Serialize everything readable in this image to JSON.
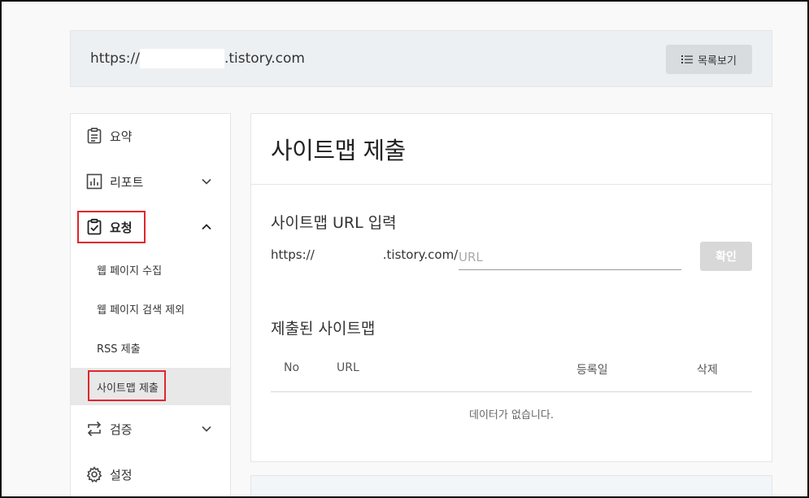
{
  "site_bar": {
    "url_prefix": "https://",
    "url_suffix": ".tistory.com",
    "list_button_label": "목록보기"
  },
  "sidebar": {
    "items": [
      {
        "label": "요약",
        "icon": "clipboard-icon"
      },
      {
        "label": "리포트",
        "icon": "chart-icon"
      },
      {
        "label": "요청",
        "icon": "clipboard-check-icon"
      },
      {
        "label": "검증",
        "icon": "swap-icon"
      },
      {
        "label": "설정",
        "icon": "gear-icon"
      }
    ],
    "sub_items": [
      {
        "label": "웹 페이지 수집"
      },
      {
        "label": "웹 페이지 검색 제외"
      },
      {
        "label": "RSS 제출"
      },
      {
        "label": "사이트맵 제출"
      }
    ]
  },
  "main": {
    "title": "사이트맵 제출",
    "input_section_title": "사이트맵 URL 입력",
    "url_prefix": "https://",
    "url_suffix": ".tistory.com/",
    "url_placeholder": "URL",
    "confirm_label": "확인",
    "submitted_title": "제출된 사이트맵",
    "table_headers": [
      "No",
      "URL",
      "등록일",
      "삭제"
    ],
    "empty_message": "데이터가 없습니다."
  }
}
